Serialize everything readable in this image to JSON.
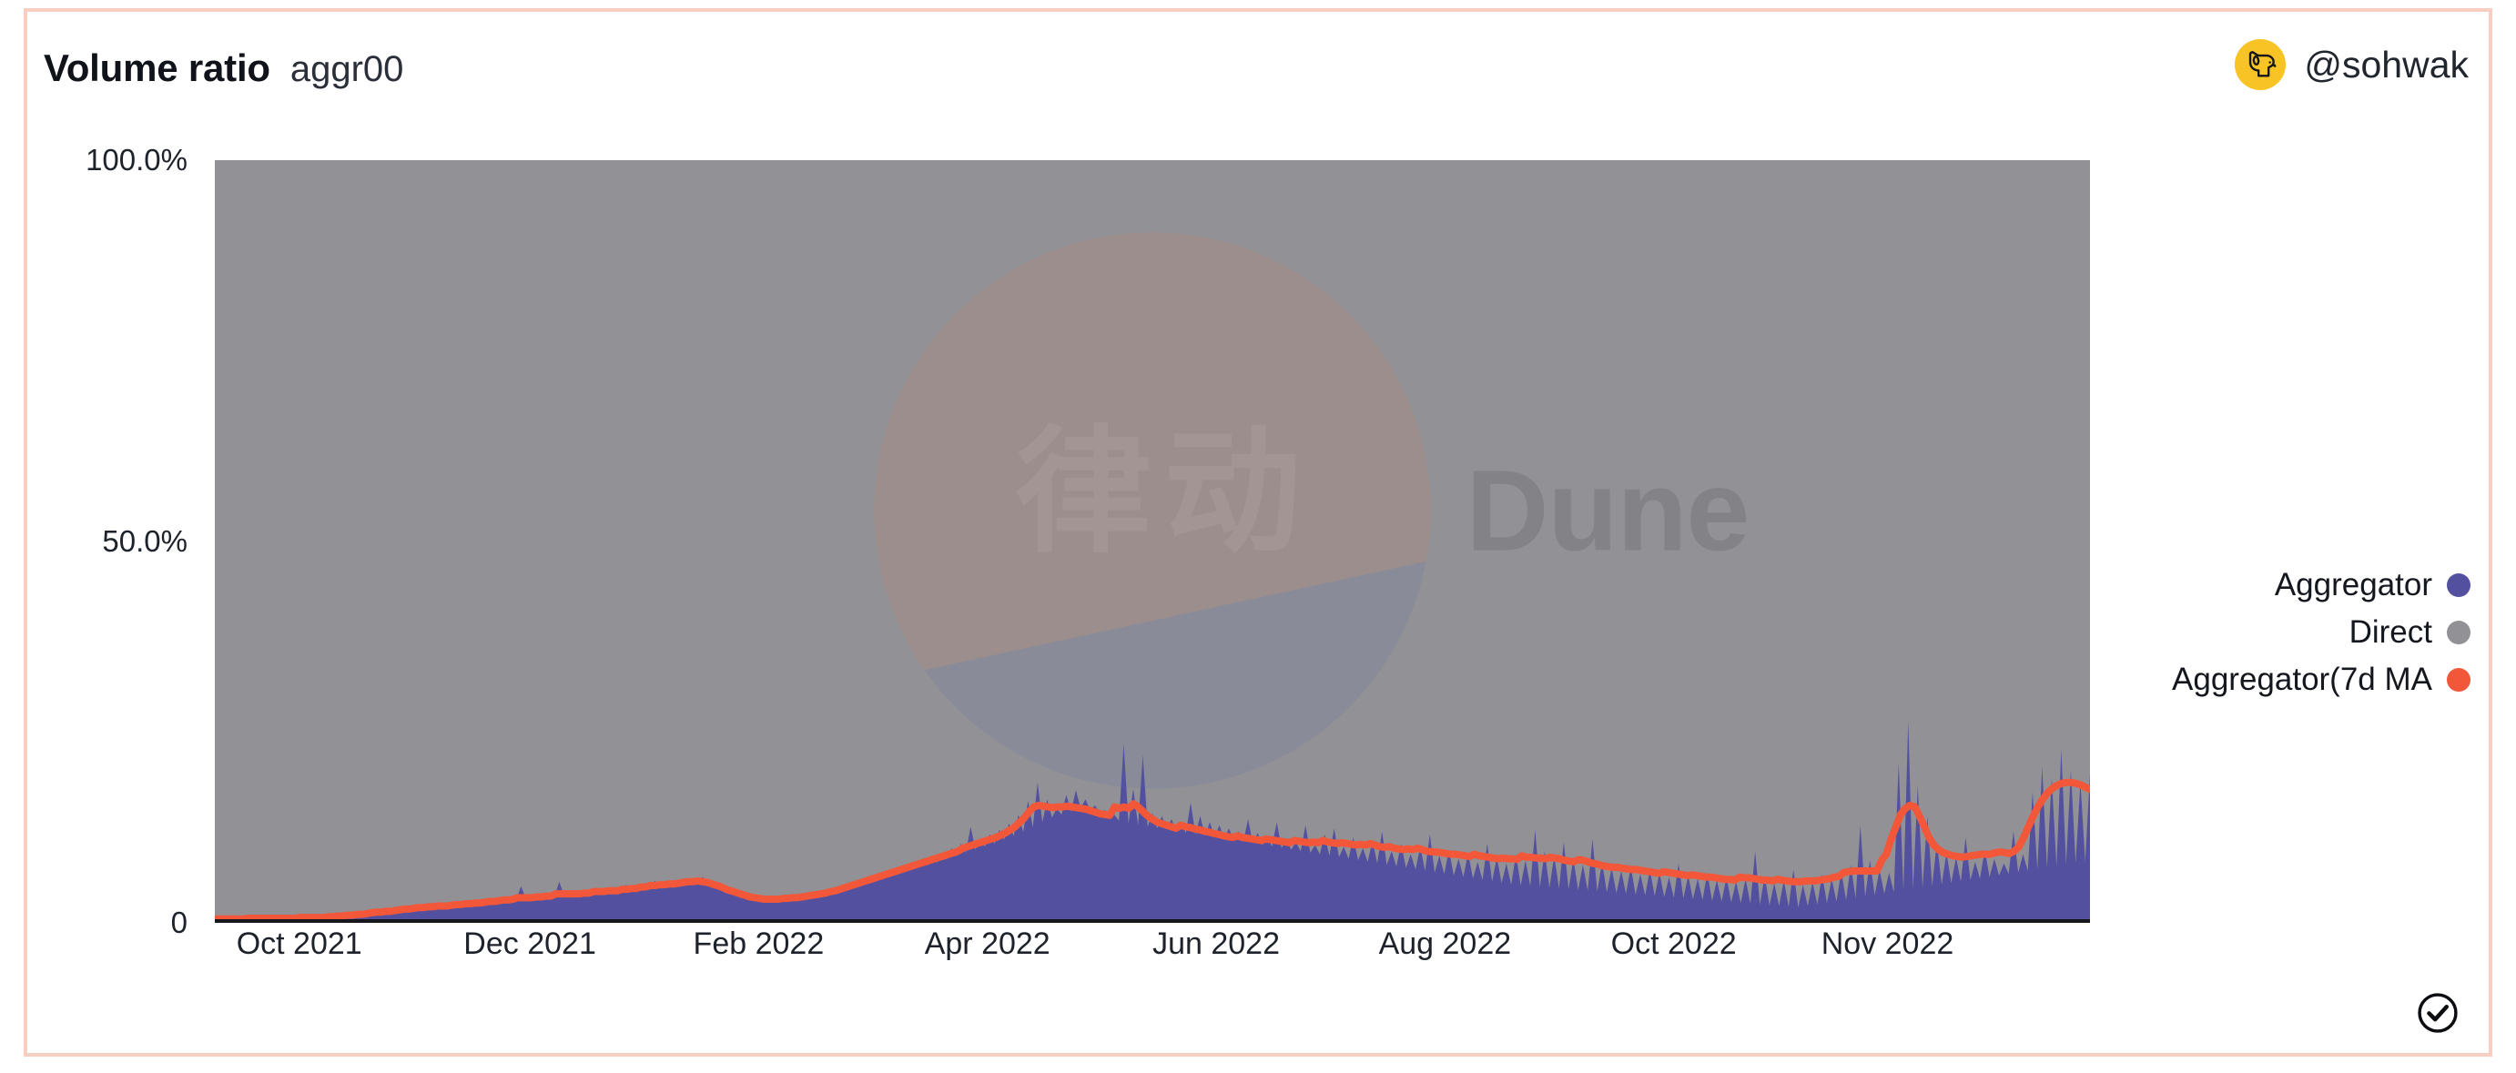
{
  "header": {
    "title": "Volume ratio",
    "subtitle": "aggr00",
    "user_handle": "@sohwak",
    "avatar_icon": "dog-head-icon",
    "avatar_bg": "#f7c325"
  },
  "footer": {
    "verified_icon": "check-circle-icon"
  },
  "watermark": {
    "brand": "Dune",
    "overlay_text": "律动",
    "logo_icon": "dune-pie-logo",
    "logo_top_color": "#e8764f",
    "logo_bottom_color": "#4f5fa8"
  },
  "legend": {
    "position": "right-middle",
    "items": [
      {
        "label": "Aggregator",
        "color": "#53519f"
      },
      {
        "label": "Direct",
        "color": "#929296"
      },
      {
        "label": "Aggregator(7d MA",
        "color": "#f2573a"
      }
    ]
  },
  "chart_data": {
    "type": "area",
    "title": "Volume ratio",
    "subtitle": "aggr00",
    "stacked": true,
    "normalized_percent": true,
    "grid": false,
    "xlabel": "",
    "ylabel": "",
    "ylim": [
      0,
      100
    ],
    "y_ticks": [
      "0",
      "50.0%",
      "100.0%"
    ],
    "y_tick_values": [
      0,
      50,
      100
    ],
    "x_ticks": [
      "Oct 2021",
      "Dec 2021",
      "Feb 2022",
      "Apr 2022",
      "Jun 2022",
      "Aug 2022",
      "Oct 2022",
      "Nov 2022"
    ],
    "x_tick_positions_pct": [
      4.5,
      16.8,
      29.0,
      41.2,
      53.4,
      65.6,
      77.8,
      85.5
    ],
    "x_range": [
      "2021-09-20",
      "2022-11-15"
    ],
    "legend_position": "right",
    "series": [
      {
        "name": "Aggregator",
        "color": "#53519f",
        "kind": "area",
        "stack_order": 1,
        "values": [
          0.4,
          0.5,
          0.4,
          0.6,
          0.5,
          0.4,
          0.6,
          0.5,
          0.7,
          0.5,
          0.6,
          0.5,
          0.4,
          0.6,
          0.5,
          0.7,
          0.6,
          0.5,
          0.8,
          0.6,
          0.7,
          0.6,
          0.8,
          0.7,
          0.9,
          0.8,
          1.0,
          0.9,
          1.1,
          1.0,
          1.3,
          1.1,
          1.5,
          1.3,
          1.6,
          1.4,
          1.7,
          1.5,
          1.8,
          1.6,
          2.0,
          1.8,
          2.1,
          1.9,
          2.2,
          2.0,
          2.4,
          2.1,
          2.3,
          2.2,
          2.5,
          2.3,
          2.6,
          2.4,
          2.7,
          2.5,
          2.8,
          2.6,
          3.0,
          2.8,
          3.1,
          2.9,
          3.3,
          3.0,
          4.8,
          3.2,
          3.4,
          3.1,
          3.5,
          3.3,
          3.8,
          3.4,
          5.4,
          3.6,
          3.8,
          3.5,
          4.0,
          3.7,
          4.2,
          3.9,
          4.5,
          4.0,
          4.3,
          4.1,
          4.6,
          4.2,
          5.0,
          4.4,
          4.8,
          4.5,
          5.2,
          4.7,
          5.5,
          4.9,
          5.1,
          4.8,
          5.3,
          5.0,
          5.6,
          5.2,
          5.8,
          5.4,
          6.0,
          5.5,
          5.2,
          4.9,
          4.6,
          4.3,
          4.1,
          3.9,
          3.7,
          3.5,
          3.3,
          3.2,
          3.0,
          2.9,
          3.1,
          3.0,
          3.2,
          3.1,
          3.4,
          3.2,
          3.6,
          3.4,
          3.8,
          3.5,
          4.0,
          3.7,
          4.3,
          3.9,
          4.6,
          4.2,
          5.0,
          4.5,
          5.4,
          4.8,
          5.8,
          5.2,
          6.2,
          5.6,
          6.6,
          6.0,
          7.0,
          6.4,
          7.4,
          6.8,
          7.8,
          7.2,
          8.2,
          7.5,
          8.8,
          7.9,
          9.2,
          8.3,
          9.8,
          8.7,
          10.4,
          9.2,
          12.6,
          9.6,
          11.0,
          10.0,
          11.6,
          10.4,
          12.2,
          10.9,
          13.0,
          11.4,
          14.2,
          11.9,
          16.0,
          12.5,
          18.4,
          13.2,
          16.2,
          13.8,
          15.0,
          14.2,
          16.8,
          14.6,
          17.4,
          15.0,
          16.2,
          14.8,
          15.4,
          14.4,
          14.8,
          13.9,
          14.2,
          13.4,
          23.5,
          13.0,
          17.6,
          12.8,
          22.0,
          12.6,
          14.4,
          12.4,
          14.0,
          12.2,
          13.6,
          12.0,
          13.2,
          11.8,
          15.8,
          11.6,
          14.0,
          11.4,
          13.2,
          11.2,
          12.8,
          11.0,
          12.4,
          10.8,
          12.0,
          10.6,
          13.6,
          10.4,
          11.8,
          10.2,
          11.4,
          10.0,
          13.2,
          9.8,
          11.0,
          9.6,
          10.6,
          9.4,
          12.8,
          9.2,
          10.2,
          9.0,
          11.6,
          8.8,
          12.4,
          8.6,
          10.0,
          8.4,
          11.2,
          8.2,
          9.8,
          8.0,
          10.8,
          7.8,
          12.0,
          7.6,
          9.4,
          7.4,
          10.4,
          7.2,
          9.0,
          7.0,
          10.0,
          6.8,
          11.6,
          6.6,
          8.8,
          6.4,
          9.6,
          6.2,
          8.4,
          6.0,
          9.2,
          5.8,
          8.0,
          5.6,
          10.4,
          5.4,
          8.6,
          5.2,
          7.8,
          5.0,
          9.0,
          4.9,
          8.2,
          4.8,
          12.2,
          4.7,
          9.4,
          4.6,
          8.8,
          4.5,
          10.6,
          4.4,
          8.4,
          4.3,
          7.6,
          4.2,
          11.0,
          4.1,
          8.0,
          4.0,
          7.2,
          3.9,
          6.8,
          3.8,
          7.4,
          3.7,
          6.4,
          3.6,
          7.0,
          3.5,
          6.6,
          3.4,
          6.0,
          3.3,
          7.8,
          3.2,
          6.2,
          3.1,
          5.8,
          3.0,
          6.6,
          2.9,
          5.6,
          2.8,
          6.0,
          2.7,
          5.4,
          2.6,
          5.8,
          2.5,
          9.4,
          2.4,
          6.2,
          2.3,
          5.2,
          2.2,
          5.6,
          2.1,
          7.0,
          2.0,
          5.0,
          2.2,
          5.4,
          2.4,
          6.4,
          2.6,
          5.8,
          2.8,
          6.8,
          3.0,
          7.6,
          3.2,
          12.8,
          3.4,
          8.2,
          3.6,
          7.0,
          3.8,
          6.6,
          4.0,
          21.0,
          4.2,
          26.5,
          4.4,
          18.0,
          4.6,
          14.0,
          4.8,
          10.6,
          5.0,
          9.2,
          5.2,
          8.6,
          5.4,
          11.2,
          5.6,
          8.0,
          5.8,
          9.6,
          6.0,
          8.4,
          6.2,
          7.8,
          6.4,
          12.0,
          6.6,
          9.0,
          6.8,
          17.2,
          7.0,
          20.5,
          7.2,
          19.0,
          7.4,
          22.8,
          7.6,
          20.0,
          7.8,
          18.5,
          8.0,
          19.6
        ]
      },
      {
        "name": "Direct",
        "color": "#929296",
        "kind": "area",
        "stack_order": 2,
        "note": "complement of Aggregator so the stack sums to 100%"
      },
      {
        "name": "Aggregator(7d MA",
        "color": "#f2573a",
        "kind": "line",
        "line_width": 8,
        "note": "7-day moving average of the Aggregator share",
        "values": [
          0.5,
          0.5,
          0.5,
          0.5,
          0.5,
          0.5,
          0.5,
          0.6,
          0.6,
          0.6,
          0.6,
          0.6,
          0.6,
          0.6,
          0.6,
          0.6,
          0.6,
          0.6,
          0.7,
          0.7,
          0.7,
          0.7,
          0.7,
          0.7,
          0.8,
          0.8,
          0.9,
          0.9,
          1.0,
          1.0,
          1.1,
          1.1,
          1.2,
          1.3,
          1.4,
          1.4,
          1.5,
          1.5,
          1.6,
          1.7,
          1.8,
          1.8,
          1.9,
          2.0,
          2.0,
          2.1,
          2.1,
          2.2,
          2.2,
          2.2,
          2.3,
          2.4,
          2.4,
          2.5,
          2.5,
          2.6,
          2.6,
          2.7,
          2.8,
          2.8,
          2.9,
          3.0,
          3.0,
          3.1,
          3.3,
          3.3,
          3.3,
          3.3,
          3.4,
          3.4,
          3.5,
          3.5,
          3.8,
          3.8,
          3.8,
          3.8,
          3.8,
          3.8,
          3.9,
          3.9,
          4.1,
          4.1,
          4.1,
          4.2,
          4.2,
          4.2,
          4.4,
          4.4,
          4.5,
          4.5,
          4.7,
          4.7,
          4.9,
          4.9,
          5.0,
          5.0,
          5.1,
          5.1,
          5.2,
          5.3,
          5.4,
          5.4,
          5.5,
          5.4,
          5.3,
          5.1,
          4.9,
          4.7,
          4.4,
          4.2,
          4.0,
          3.8,
          3.6,
          3.4,
          3.3,
          3.2,
          3.1,
          3.1,
          3.1,
          3.1,
          3.2,
          3.2,
          3.3,
          3.3,
          3.4,
          3.5,
          3.6,
          3.7,
          3.8,
          3.9,
          4.1,
          4.2,
          4.4,
          4.6,
          4.8,
          5.0,
          5.2,
          5.4,
          5.6,
          5.8,
          6.0,
          6.2,
          6.4,
          6.6,
          6.8,
          7.0,
          7.2,
          7.4,
          7.6,
          7.8,
          8.0,
          8.2,
          8.4,
          8.6,
          8.8,
          9.0,
          9.2,
          9.4,
          9.8,
          10.0,
          10.2,
          10.4,
          10.6,
          10.8,
          11.0,
          11.2,
          11.5,
          11.8,
          12.2,
          12.6,
          13.2,
          13.8,
          14.6,
          15.2,
          15.4,
          15.3,
          15.2,
          15.1,
          15.2,
          15.2,
          15.3,
          15.2,
          15.1,
          15.0,
          14.9,
          14.7,
          14.5,
          14.3,
          14.2,
          14.1,
          15.2,
          15.0,
          15.2,
          15.0,
          15.6,
          15.2,
          14.6,
          14.0,
          13.6,
          13.2,
          13.0,
          12.8,
          12.6,
          12.4,
          12.8,
          12.6,
          12.5,
          12.3,
          12.2,
          12.0,
          11.9,
          11.7,
          11.6,
          11.4,
          11.3,
          11.2,
          11.4,
          11.2,
          11.1,
          11.0,
          10.9,
          10.8,
          11.0,
          10.9,
          10.8,
          10.7,
          10.6,
          10.5,
          10.8,
          10.7,
          10.6,
          10.5,
          10.6,
          10.5,
          10.8,
          10.6,
          10.5,
          10.4,
          10.5,
          10.4,
          10.3,
          10.2,
          10.3,
          10.2,
          10.4,
          10.2,
          10.0,
          9.9,
          10.0,
          9.8,
          9.7,
          9.6,
          9.7,
          9.6,
          9.8,
          9.6,
          9.4,
          9.3,
          9.3,
          9.2,
          9.1,
          9.0,
          9.0,
          8.9,
          8.8,
          8.7,
          9.0,
          8.8,
          8.7,
          8.6,
          8.5,
          8.4,
          8.5,
          8.4,
          8.4,
          8.3,
          8.8,
          8.6,
          8.6,
          8.5,
          8.5,
          8.4,
          8.6,
          8.5,
          8.4,
          8.2,
          8.1,
          8.0,
          8.3,
          8.2,
          8.0,
          7.8,
          7.7,
          7.5,
          7.4,
          7.3,
          7.3,
          7.2,
          7.1,
          7.0,
          7.0,
          6.9,
          6.8,
          6.7,
          6.6,
          6.5,
          6.7,
          6.6,
          6.5,
          6.4,
          6.3,
          6.2,
          6.3,
          6.2,
          6.1,
          6.0,
          6.0,
          5.9,
          5.8,
          5.7,
          5.7,
          5.6,
          6.0,
          5.9,
          5.9,
          5.8,
          5.7,
          5.6,
          5.6,
          5.5,
          5.7,
          5.6,
          5.5,
          5.4,
          5.4,
          5.4,
          5.5,
          5.5,
          5.5,
          5.6,
          5.7,
          5.8,
          6.0,
          6.1,
          6.6,
          6.7,
          6.8,
          6.8,
          6.8,
          6.8,
          6.8,
          6.8,
          8.2,
          9.0,
          11.0,
          12.6,
          14.2,
          15.0,
          15.4,
          15.2,
          14.0,
          12.6,
          11.2,
          10.2,
          9.6,
          9.2,
          9.0,
          8.8,
          8.7,
          8.6,
          8.7,
          8.8,
          8.9,
          9.0,
          9.0,
          9.0,
          9.2,
          9.3,
          9.2,
          9.1,
          9.4,
          10.0,
          11.2,
          12.6,
          14.0,
          15.2,
          16.2,
          17.0,
          17.6,
          18.0,
          18.3,
          18.4,
          18.4,
          18.3,
          18.1,
          17.8,
          17.5
        ]
      }
    ]
  }
}
